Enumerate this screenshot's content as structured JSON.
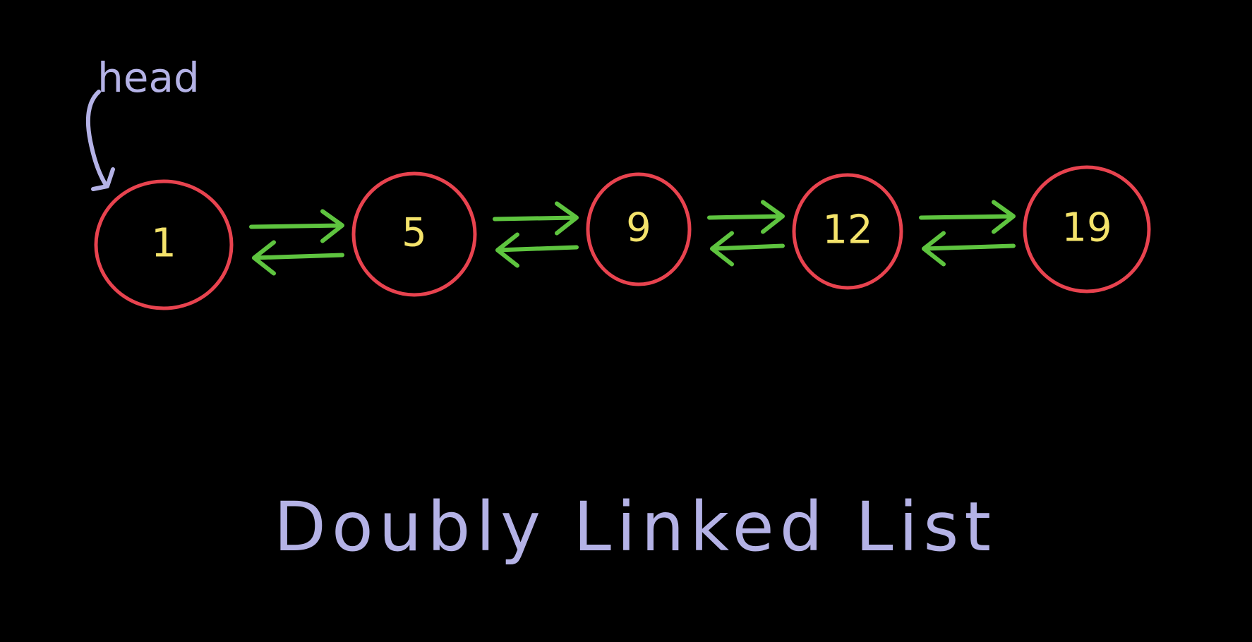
{
  "head_label": "head",
  "title": "Doubly Linked List",
  "nodes": [
    {
      "value": "1"
    },
    {
      "value": "5"
    },
    {
      "value": "9"
    },
    {
      "value": "12"
    },
    {
      "value": "19"
    }
  ],
  "colors": {
    "background": "#000000",
    "node_outline": "#e8434f",
    "node_text": "#f4e36b",
    "link_arrow": "#5ec43f",
    "label": "#b4b2e6"
  }
}
